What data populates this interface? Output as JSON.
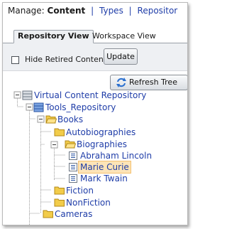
{
  "header": {
    "prefix": "Manage:",
    "current": "Content",
    "links": [
      "Types",
      "Repositor"
    ]
  },
  "tabs": [
    {
      "label": "Repository View",
      "active": true
    },
    {
      "label": "Workspace View",
      "active": false
    }
  ],
  "options": {
    "hide_retired_label": "Hide Retired Content",
    "hide_retired_checked": false,
    "update_label": "Update"
  },
  "toolbar": {
    "refresh_label": "Refresh Tree"
  },
  "tree": {
    "root": "Virtual Content Repository",
    "repository": "Tools_Repository",
    "books": "Books",
    "autobiographies": "Autobiographies",
    "biographies": "Biographies",
    "bio_items": [
      "Abraham Lincoln",
      "Marie Curie",
      "Mark Twain"
    ],
    "fiction": "Fiction",
    "nonfiction": "NonFiction",
    "cameras": "Cameras",
    "selected": "Marie Curie"
  },
  "colors": {
    "link": "#1f3da8",
    "selection_bg": "#fde4b7",
    "folder": "#f2cc4a"
  }
}
